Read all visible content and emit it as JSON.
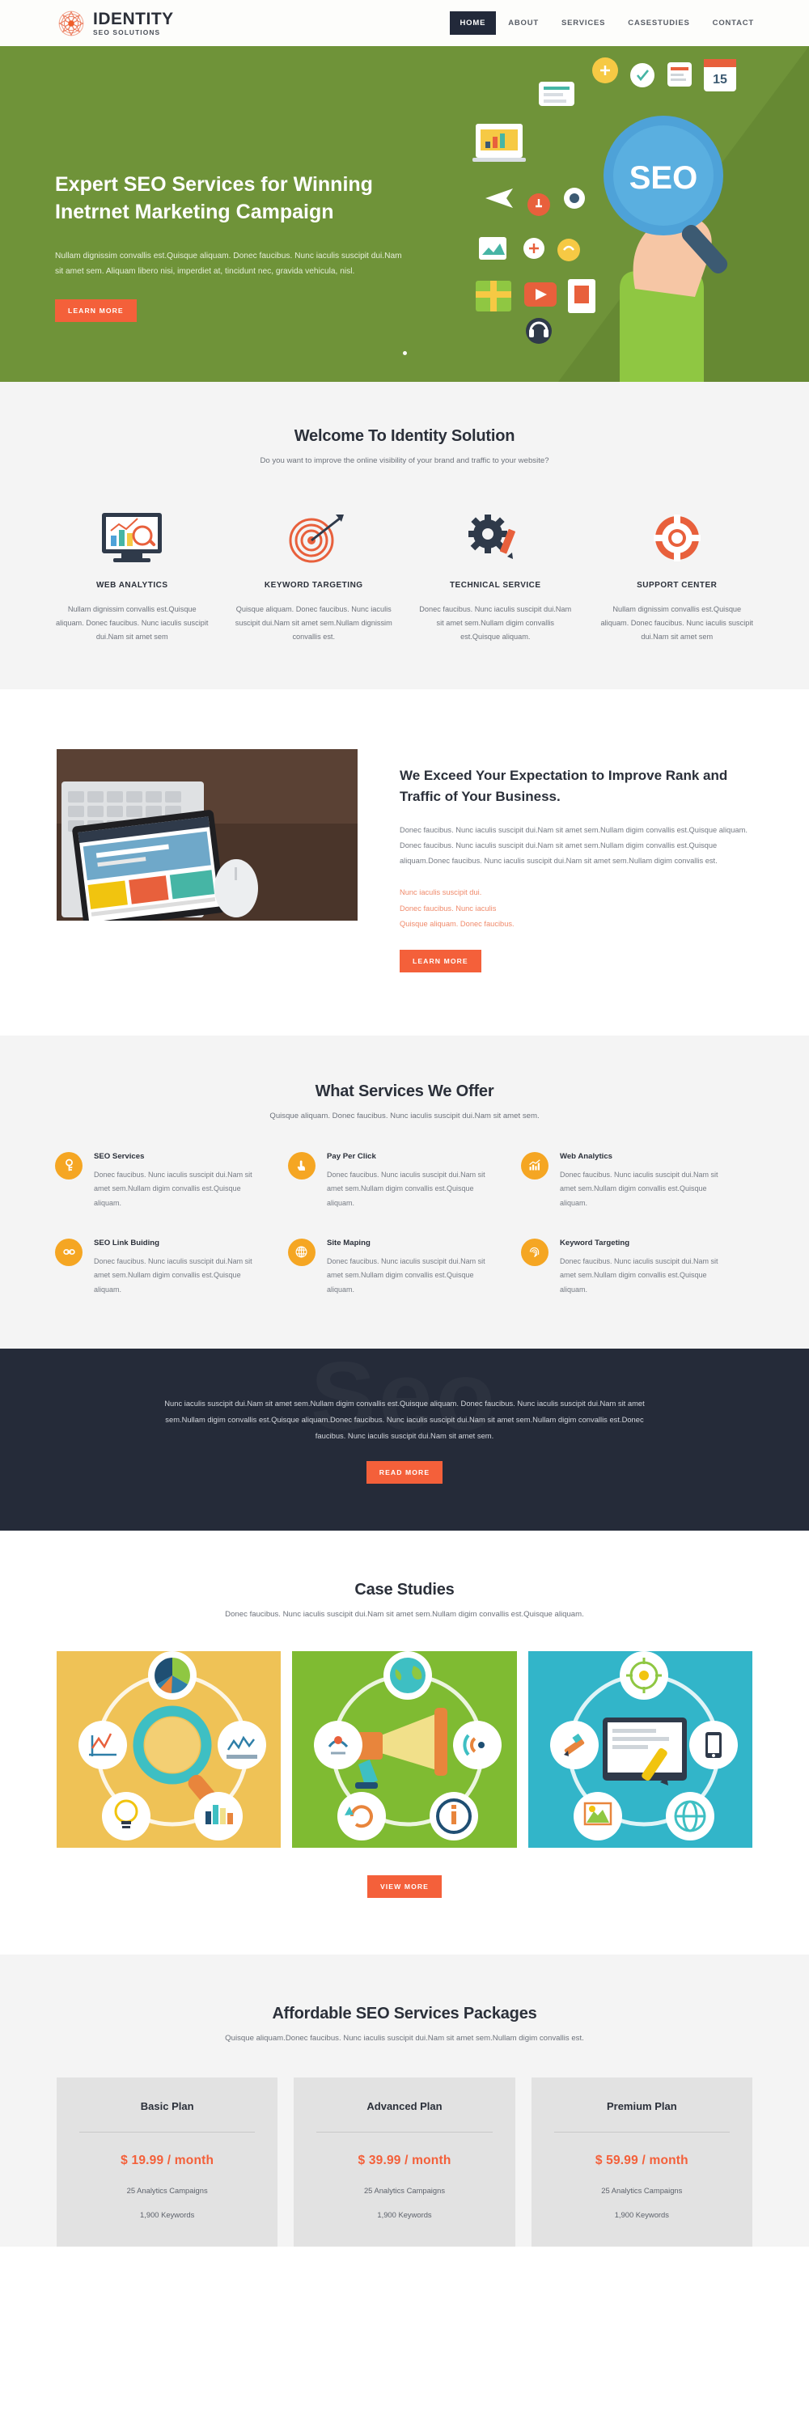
{
  "brand": {
    "name": "IDENTITY",
    "tagline": "SEO SOLUTIONS",
    "logo_icon": "flower-mandala-logo-icon"
  },
  "nav": {
    "items": [
      {
        "label": "HOME",
        "active": true
      },
      {
        "label": "ABOUT",
        "active": false
      },
      {
        "label": "SERVICES",
        "active": false
      },
      {
        "label": "CASESTUDIES",
        "active": false
      },
      {
        "label": "CONTACT",
        "active": false
      }
    ]
  },
  "hero": {
    "title": "Expert SEO Services for Winning Inetrnet Marketing Campaign",
    "subtitle": "Nullam dignissim convallis est.Quisque aliquam. Donec faucibus. Nunc iaculis suscipit dui.Nam sit amet sem. Aliquam libero nisi, imperdiet at, tincidunt nec, gravida vehicula, nisl.",
    "button": "LEARN MORE",
    "art_label": "SEO",
    "slider_dots": 1,
    "bg_color": "#6f9339"
  },
  "welcome": {
    "title": "Welcome To Identity Solution",
    "subtitle": "Do you want to improve the online visibility of your brand and traffic to your website?",
    "features": [
      {
        "icon": "monitor-analytics-icon",
        "title": "WEB ANALYTICS",
        "text": "Nullam dignissim convallis est.Quisque aliquam. Donec faucibus. Nunc iaculis suscipit dui.Nam sit amet sem"
      },
      {
        "icon": "target-dartboard-icon",
        "title": "KEYWORD TARGETING",
        "text": "Quisque aliquam. Donec faucibus. Nunc iaculis suscipit dui.Nam sit amet sem.Nullam dignissim convallis est."
      },
      {
        "icon": "gear-pencil-icon",
        "title": "TECHNICAL SERVICE",
        "text": "Donec faucibus. Nunc iaculis suscipit dui.Nam sit amet sem.Nullam digim convallis est.Quisque aliquam."
      },
      {
        "icon": "lifebuoy-support-icon",
        "title": "SUPPORT CENTER",
        "text": "Nullam dignissim convallis est.Quisque aliquam. Donec faucibus. Nunc iaculis suscipit dui.Nam sit amet sem"
      }
    ]
  },
  "exceed": {
    "image_alt": "tablet-keyboard-desk-photo",
    "title": "We Exceed Your Expectation to Improve Rank and Traffic of Your Business.",
    "text": "Donec faucibus. Nunc iaculis suscipit dui.Nam sit amet sem.Nullam digim convallis est.Quisque aliquam. Donec faucibus. Nunc iaculis suscipit dui.Nam sit amet sem.Nullam digim convallis est.Quisque aliquam.Donec faucibus. Nunc iaculis suscipit dui.Nam sit amet sem.Nullam digim convallis est.",
    "highlights": [
      "Nunc iaculis suscipit dui.",
      "Donec faucibus. Nunc iaculis",
      "Quisque aliquam. Donec faucibus."
    ],
    "button": "LEARN MORE"
  },
  "services": {
    "title": "What Services We Offer",
    "subtitle": "Quisque aliquam. Donec faucibus. Nunc iaculis suscipit dui.Nam sit amet sem.",
    "items": [
      {
        "icon": "key-icon",
        "name": "SEO Services",
        "text": "Donec faucibus. Nunc iaculis suscipit dui.Nam sit amet sem.Nullam digim convallis est.Quisque aliquam."
      },
      {
        "icon": "hand-pointer-icon",
        "name": "Pay Per Click",
        "text": "Donec faucibus. Nunc iaculis suscipit dui.Nam sit amet sem.Nullam digim convallis est.Quisque aliquam."
      },
      {
        "icon": "bar-chart-growth-icon",
        "name": "Web Analytics",
        "text": "Donec faucibus. Nunc iaculis suscipit dui.Nam sit amet sem.Nullam digim convallis est.Quisque aliquam."
      },
      {
        "icon": "chain-link-icon",
        "name": "SEO Link Buiding",
        "text": "Donec faucibus. Nunc iaculis suscipit dui.Nam sit amet sem.Nullam digim convallis est.Quisque aliquam."
      },
      {
        "icon": "globe-grid-icon",
        "name": "Site Maping",
        "text": "Donec faucibus. Nunc iaculis suscipit dui.Nam sit amet sem.Nullam digim convallis est.Quisque aliquam."
      },
      {
        "icon": "fingerprint-icon",
        "name": "Keyword Targeting",
        "text": "Donec faucibus. Nunc iaculis suscipit dui.Nam sit amet sem.Nullam digim convallis est.Quisque aliquam."
      }
    ]
  },
  "cta": {
    "ghost_text": "Seo",
    "text": "Nunc iaculis suscipit dui.Nam sit amet sem.Nullam digim convallis est.Quisque aliquam. Donec faucibus. Nunc iaculis suscipit dui.Nam sit amet sem.Nullam digim convallis est.Quisque aliquam.Donec faucibus. Nunc iaculis suscipit dui.Nam sit amet sem.Nullam digim convallis est.Donec faucibus. Nunc iaculis suscipit dui.Nam sit amet sem.",
    "button": "READ MORE",
    "bg_color": "#252b39"
  },
  "case_studies": {
    "title": "Case Studies",
    "subtitle": "Donec faucibus. Nunc iaculis suscipit dui.Nam sit amet sem.Nullam digim convallis est.Quisque aliquam.",
    "cards": [
      {
        "icon": "magnifier-analytics-circle-icon",
        "bg_color": "#efc256"
      },
      {
        "icon": "megaphone-marketing-circle-icon",
        "bg_color": "#7fbb32"
      },
      {
        "icon": "tablet-content-circle-icon",
        "bg_color": "#32b5c9"
      }
    ],
    "button": "VIEW MORE"
  },
  "pricing": {
    "title": "Affordable SEO Services Packages",
    "subtitle": "Quisque aliquam.Donec faucibus. Nunc iaculis suscipit dui.Nam sit amet sem.Nullam digim convallis est.",
    "plans": [
      {
        "name": "Basic Plan",
        "price": "$ 19.99 / month",
        "features": [
          "25 Analytics Campaigns",
          "1,900 Keywords"
        ]
      },
      {
        "name": "Advanced Plan",
        "price": "$ 39.99 / month",
        "features": [
          "25 Analytics Campaigns",
          "1,900 Keywords"
        ]
      },
      {
        "name": "Premium Plan",
        "price": "$ 59.99 / month",
        "features": [
          "25 Analytics Campaigns",
          "1,900 Keywords"
        ]
      }
    ]
  },
  "colors": {
    "accent": "#f4603a",
    "green": "#6f9339",
    "dark": "#252b39",
    "amber": "#f5a623"
  }
}
